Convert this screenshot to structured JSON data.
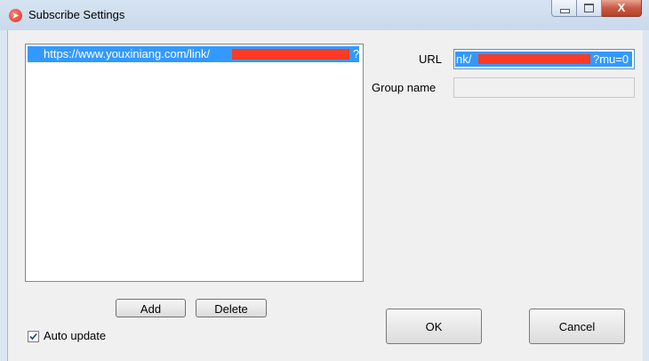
{
  "window": {
    "title": "Subscribe Settings",
    "close_glyph": "X"
  },
  "icons": {
    "app": "app-logo-icon",
    "minimize": "minimize-icon",
    "maximize": "maximize-icon",
    "close": "close-icon",
    "check": "checkmark-icon"
  },
  "colors": {
    "selection": "#3399ff",
    "redaction": "#fb3b25",
    "close_button": "#c75a44"
  },
  "list": {
    "items": [
      {
        "prefix": "https://www.youxiniang.com/link/",
        "suffix": "?",
        "selected": true
      }
    ]
  },
  "form": {
    "url_label": "URL",
    "url_value_start": "nk/",
    "url_value_end": "?mu=0",
    "group_label": "Group name",
    "group_value": ""
  },
  "buttons": {
    "add": "Add",
    "delete": "Delete",
    "ok": "OK",
    "cancel": "Cancel"
  },
  "options": {
    "auto_update_label": "Auto update",
    "auto_update_checked": true
  }
}
